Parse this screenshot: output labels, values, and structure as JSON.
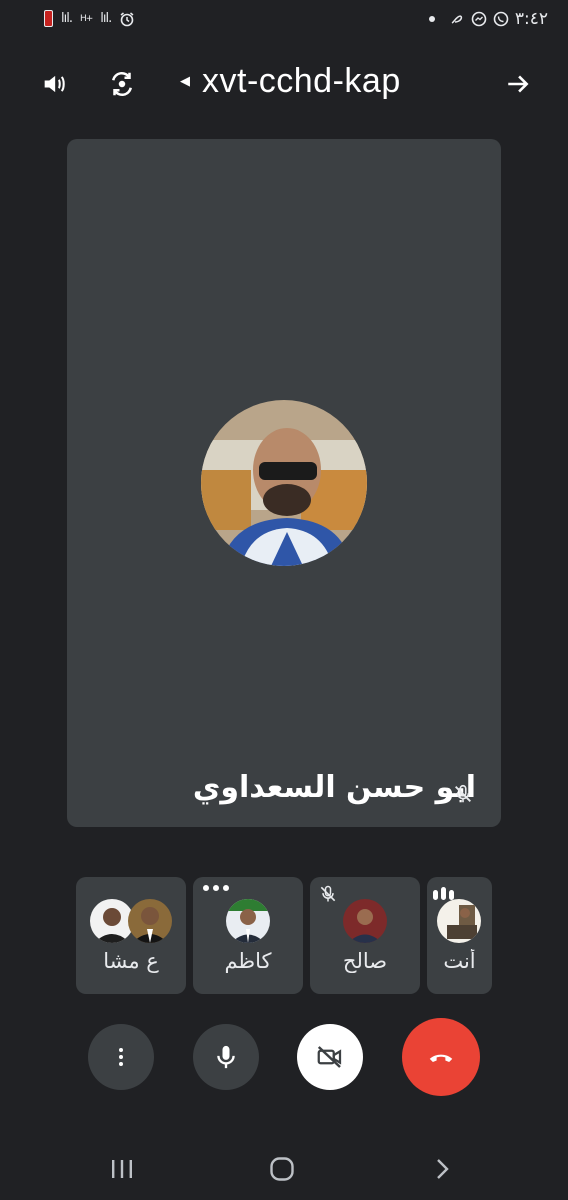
{
  "status_bar": {
    "clock": "٣:٤٢",
    "signal1": "lıl.",
    "signal2": "lıl.",
    "data_indicator": "H+",
    "battery_color": "#c5221f",
    "icons": [
      "battery-icon",
      "signal-icon",
      "alarm-icon",
      "dot-icon",
      "nfc-icon",
      "messenger-icon",
      "whatsapp-icon"
    ]
  },
  "top_bar": {
    "meeting_code": "xvt-cchd-kap",
    "icons": [
      "speaker-icon",
      "switch-camera-icon",
      "caret-left-icon",
      "arrow-right-icon"
    ]
  },
  "main_speaker": {
    "name": "ابو حسن السعداوي",
    "muted": true
  },
  "participants": [
    {
      "label": "ع مشا",
      "avatars": 2,
      "indicator": "none"
    },
    {
      "label": "كاظم",
      "avatars": 1,
      "indicator": "more-dots"
    },
    {
      "label": "صالح",
      "avatars": 1,
      "indicator": "mic-off"
    },
    {
      "label": "أنت",
      "avatars": 1,
      "indicator": "audio-bars"
    }
  ],
  "controls": {
    "icons": [
      "more-vert-icon",
      "mic-icon",
      "camera-off-icon",
      "end-call-icon"
    ],
    "end_call_color": "#ea4335"
  },
  "nav_bar": {
    "icons": [
      "recents-icon",
      "home-icon",
      "back-icon"
    ]
  },
  "colors": {
    "background": "#202124",
    "tile": "#3c4043",
    "accent_red": "#ea4335"
  }
}
